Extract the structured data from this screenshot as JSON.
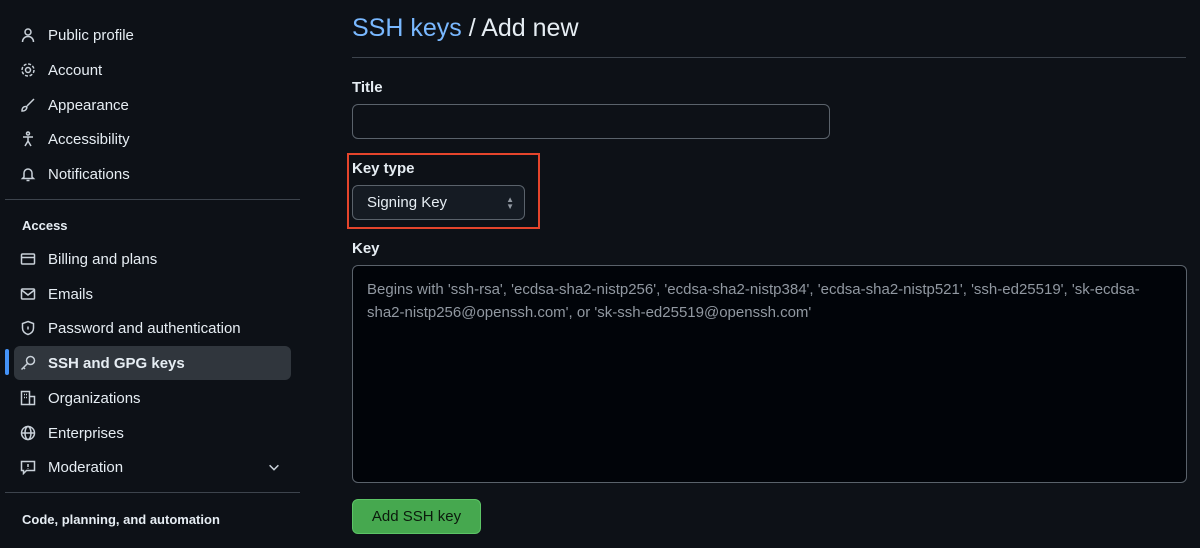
{
  "sidebar": {
    "items": [
      {
        "label": "Public profile",
        "icon": "person-icon"
      },
      {
        "label": "Account",
        "icon": "gear-icon"
      },
      {
        "label": "Appearance",
        "icon": "paintbrush-icon"
      },
      {
        "label": "Accessibility",
        "icon": "accessibility-icon"
      },
      {
        "label": "Notifications",
        "icon": "bell-icon"
      }
    ],
    "access_heading": "Access",
    "access_items": [
      {
        "label": "Billing and plans",
        "icon": "credit-card-icon"
      },
      {
        "label": "Emails",
        "icon": "mail-icon"
      },
      {
        "label": "Password and authentication",
        "icon": "shield-lock-icon"
      },
      {
        "label": "SSH and GPG keys",
        "icon": "key-icon",
        "active": true
      },
      {
        "label": "Organizations",
        "icon": "organization-icon"
      },
      {
        "label": "Enterprises",
        "icon": "globe-icon"
      },
      {
        "label": "Moderation",
        "icon": "report-icon"
      }
    ],
    "code_heading": "Code, planning, and automation"
  },
  "header": {
    "link": "SSH keys",
    "title": " / Add new"
  },
  "form": {
    "title_label": "Title",
    "title_value": "",
    "key_type_label": "Key type",
    "key_type_value": "Signing Key",
    "key_label": "Key",
    "key_placeholder": "Begins with 'ssh-rsa', 'ecdsa-sha2-nistp256', 'ecdsa-sha2-nistp384', 'ecdsa-sha2-nistp521', 'ssh-ed25519', 'sk-ecdsa-sha2-nistp256@openssh.com', or 'sk-ssh-ed25519@openssh.com'",
    "submit_label": "Add SSH key"
  },
  "colors": {
    "accent": "#4493f8",
    "highlight_box": "#e5452c",
    "button": "#46a84f"
  }
}
